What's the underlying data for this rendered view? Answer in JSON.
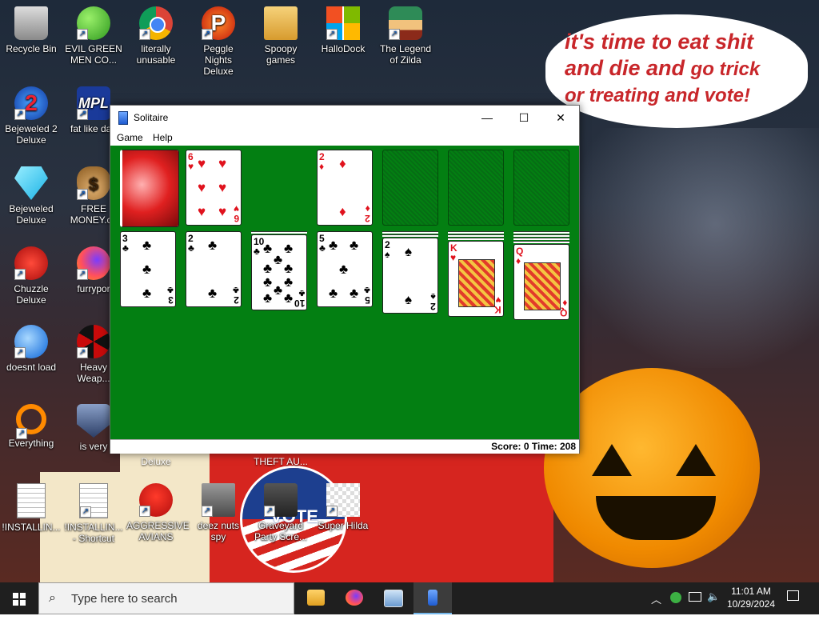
{
  "desktop": {
    "icons": [
      {
        "label": "Recycle Bin",
        "icon": "recycle-bin-icon"
      },
      {
        "label": "EVIL GREEN MEN CO...",
        "icon": "people-icon"
      },
      {
        "label": "literally unusable",
        "icon": "chrome-icon"
      },
      {
        "label": "Peggle Nights Deluxe",
        "icon": "peggle-icon"
      },
      {
        "label": "Spoopy games",
        "icon": "folder-icon"
      },
      {
        "label": "HalloDock",
        "icon": "windows-logo-icon"
      },
      {
        "label": "The Legend of Zilda",
        "icon": "zelda-icon"
      },
      {
        "label": "Bejeweled 2 Deluxe",
        "icon": "bejeweled2-icon"
      },
      {
        "label": "fat like darl",
        "icon": "mp-icon"
      },
      {
        "label": "Bejeweled Deluxe",
        "icon": "gem-icon"
      },
      {
        "label": "FREE MONEY.co",
        "icon": "money-bag-icon"
      },
      {
        "label": "Chuzzle Deluxe",
        "icon": "chuzzle-icon"
      },
      {
        "label": "furrypor",
        "icon": "firefox-icon"
      },
      {
        "label": "doesnt load",
        "icon": "thunderbird-icon"
      },
      {
        "label": "Heavy Weap...",
        "icon": "radiation-icon"
      },
      {
        "label": "Everything",
        "icon": "everything-search-icon"
      },
      {
        "label": "is very",
        "icon": "mpl-shield-icon"
      },
      {
        "label": "!INSTALLIN...",
        "icon": "text-file-icon"
      },
      {
        "label": "!INSTALLIN... - Shortcut",
        "icon": "text-file-icon"
      },
      {
        "label": "AGGRESSIVE AVIANS",
        "icon": "angry-bird-icon"
      },
      {
        "label": "deez nuts spy",
        "icon": "stacked-windows-icon"
      },
      {
        "label": "Graveyard Party Scre...",
        "icon": "graveyard-icon"
      },
      {
        "label": "Super Hilda",
        "icon": "pixel-character-icon"
      }
    ],
    "partial_labels": [
      "Deluxe",
      "THEFT AU..."
    ],
    "bubble": {
      "line1": "it's time to eat shit",
      "line2a": "and die and",
      "line2b": "go trick",
      "line3": "or treating and vote!"
    },
    "badge_text": "VOTE",
    "colors": {
      "bubble_text": "#c8262a",
      "felt": "#037f12"
    }
  },
  "solitaire": {
    "title": "Solitaire",
    "controls": {
      "minimize": "—",
      "maximize": "☐",
      "close": "✕"
    },
    "menu": [
      "Game",
      "Help"
    ],
    "status": "Score: 0 Time: 208",
    "waste_card": {
      "rank": "6",
      "suit": "♥",
      "color": "red"
    },
    "foundation_card": {
      "rank": "2",
      "suit": "♦",
      "color": "red"
    },
    "tableau": [
      {
        "rank": "3",
        "suit": "♣",
        "color": "black"
      },
      {
        "rank": "2",
        "suit": "♣",
        "color": "black"
      },
      {
        "rank": "10",
        "suit": "♣",
        "color": "black"
      },
      {
        "rank": "5",
        "suit": "♣",
        "color": "black"
      },
      {
        "rank": "2",
        "suit": "♠",
        "color": "black"
      },
      {
        "rank": "K",
        "suit": "♥",
        "color": "red"
      },
      {
        "rank": "Q",
        "suit": "♦",
        "color": "red"
      }
    ]
  },
  "taskbar": {
    "search_placeholder": "Type here to search",
    "apps": [
      "file-explorer-icon",
      "firefox-icon",
      "control-panel-icon",
      "solitaire-icon"
    ],
    "time": "11:01 AM",
    "date": "10/29/2024"
  }
}
